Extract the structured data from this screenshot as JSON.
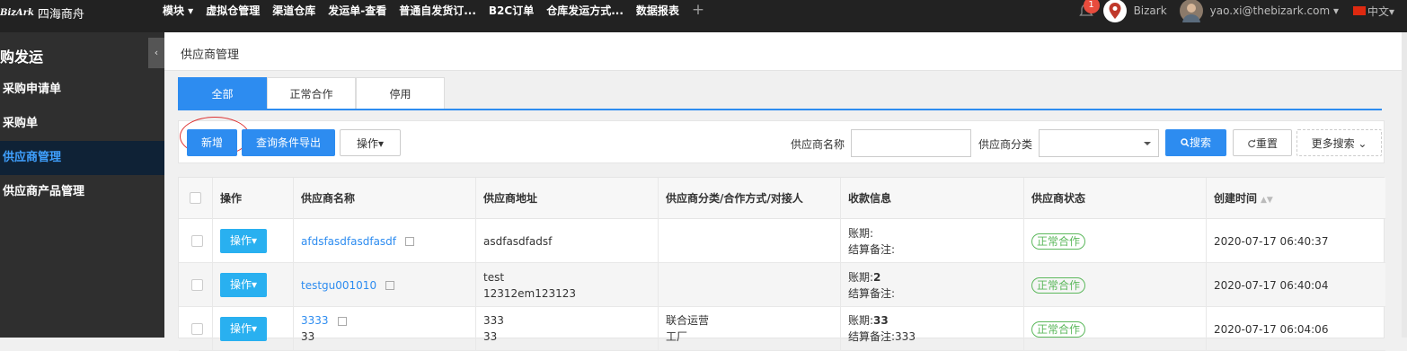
{
  "app": {
    "logo_mark": "BizArk",
    "name": "四海商舟"
  },
  "nav": {
    "items": [
      "模块 ▾",
      "虚拟仓管理",
      "渠道仓库",
      "发运单-查看",
      "普通自发货订...",
      "B2C订单",
      "仓库发运方式...",
      "数据报表"
    ],
    "add": "+"
  },
  "user": {
    "bell_count": "1",
    "org_name": "Bizark",
    "email": "yao.xi@thebizark.com ▾",
    "language": "中文▾"
  },
  "sidebar": {
    "title": "购发运",
    "items": [
      "采购申请单",
      "采购单",
      "供应商管理",
      "供应商产品管理"
    ],
    "active_index": 2,
    "collapse_icon": "‹"
  },
  "page": {
    "title": "供应商管理"
  },
  "tabs": [
    "全部",
    "正常合作",
    "停用"
  ],
  "toolbar": {
    "add": "新增",
    "export": "查询条件导出",
    "ops": "操作▾",
    "name_label": "供应商名称",
    "name_value": "",
    "category_label": "供应商分类",
    "category_value": "",
    "search": "搜索",
    "reset": "重置",
    "more": "更多搜索 ⌄"
  },
  "table": {
    "columns": [
      "操作",
      "供应商名称",
      "供应商地址",
      "供应商分类/合作方式/对接人",
      "收款信息",
      "供应商状态",
      "创建时间"
    ],
    "op_label": "操作▾",
    "rows": [
      {
        "name": "afdsfasdfasdfasdf",
        "address": [
          "asdfasdfadsf"
        ],
        "category": [],
        "payment_term": "账期:",
        "payment_term_value": "",
        "settle_note": "结算备注:",
        "status": "正常合作",
        "created": "2020-07-17 06:40:37"
      },
      {
        "name": "testgu001010",
        "address": [
          "test",
          "12312em123123"
        ],
        "category": [],
        "payment_term": "账期:",
        "payment_term_value": "2",
        "settle_note": "结算备注:",
        "status": "正常合作",
        "created": "2020-07-17 06:40:04"
      },
      {
        "name": "3333",
        "address": [
          "333",
          "33"
        ],
        "category": [
          "联合运营",
          "工厂"
        ],
        "payment_term": "账期:",
        "payment_term_value": "33",
        "settle_note": "结算备注:333",
        "status": "正常合作",
        "created": "2020-07-17 06:04:06"
      }
    ]
  },
  "colors": {
    "primary": "#2d8cf0",
    "op_button": "#29b0f0",
    "status_green": "#5cb85c",
    "topbar": "#222222",
    "sidebar": "#2f2f2f",
    "sidebar_active": "#0f2236"
  }
}
